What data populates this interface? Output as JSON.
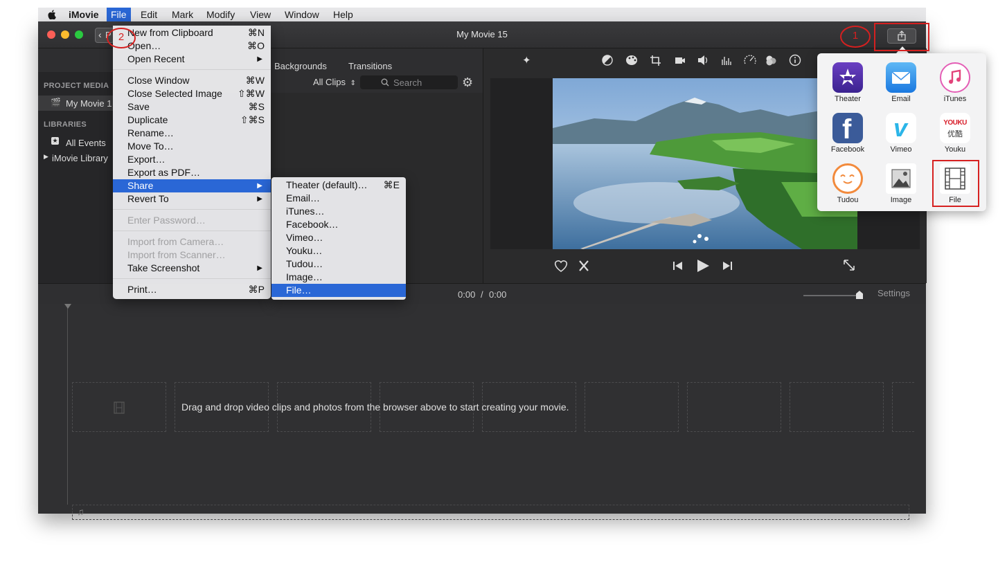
{
  "menubar": {
    "apple_icon": "apple-icon",
    "items": [
      "iMovie",
      "File",
      "Edit",
      "Mark",
      "Modify",
      "View",
      "Window",
      "Help"
    ]
  },
  "window": {
    "title": "My Movie 15",
    "back_label": "P"
  },
  "annotations": {
    "one": "1",
    "two": "2"
  },
  "sidebar": {
    "project_media_heading": "PROJECT MEDIA",
    "project_item": "My Movie 1",
    "libraries_heading": "LIBRARIES",
    "all_events": "All Events",
    "library": "iMovie Library"
  },
  "browser": {
    "tabs": [
      "Backgrounds",
      "Transitions"
    ],
    "filter": "All Clips",
    "search_placeholder": "Search"
  },
  "file_menu": {
    "items": [
      {
        "label": "New from Clipboard",
        "shortcut": "⌘N"
      },
      {
        "label": "Open…",
        "shortcut": "⌘O"
      },
      {
        "label": "Open Recent"
      },
      {
        "label": "Close Window",
        "shortcut": "⌘W"
      },
      {
        "label": "Close Selected Image",
        "shortcut": "⇧⌘W"
      },
      {
        "label": "Save",
        "shortcut": "⌘S"
      },
      {
        "label": "Duplicate",
        "shortcut": "⇧⌘S"
      },
      {
        "label": "Rename…"
      },
      {
        "label": "Move To…"
      },
      {
        "label": "Export…"
      },
      {
        "label": "Export as PDF…"
      },
      {
        "label": "Share"
      },
      {
        "label": "Revert To"
      },
      {
        "label": "Enter Password…"
      },
      {
        "label": "Import from Camera…"
      },
      {
        "label": "Import from Scanner…"
      },
      {
        "label": "Take Screenshot"
      },
      {
        "label": "Print…",
        "shortcut": "⌘P"
      }
    ]
  },
  "share_menu": {
    "items": [
      {
        "label": "Theater (default)…",
        "shortcut": "⌘E"
      },
      {
        "label": "Email…"
      },
      {
        "label": "iTunes…"
      },
      {
        "label": "Facebook…"
      },
      {
        "label": "Vimeo…"
      },
      {
        "label": "Youku…"
      },
      {
        "label": "Tudou…"
      },
      {
        "label": "Image…"
      },
      {
        "label": "File…"
      }
    ]
  },
  "share_popover": {
    "items": [
      "Theater",
      "Email",
      "iTunes",
      "Facebook",
      "Vimeo",
      "Youku",
      "Tudou",
      "Image",
      "File"
    ],
    "youku_logo": "YOUKU",
    "youku_cn": "优酷"
  },
  "timeline": {
    "time_current": "0:00",
    "time_sep": "/",
    "time_total": "0:00",
    "settings_label": "Settings",
    "drop_hint": "Drag and drop video clips and photos from the browser above to start creating your movie."
  }
}
